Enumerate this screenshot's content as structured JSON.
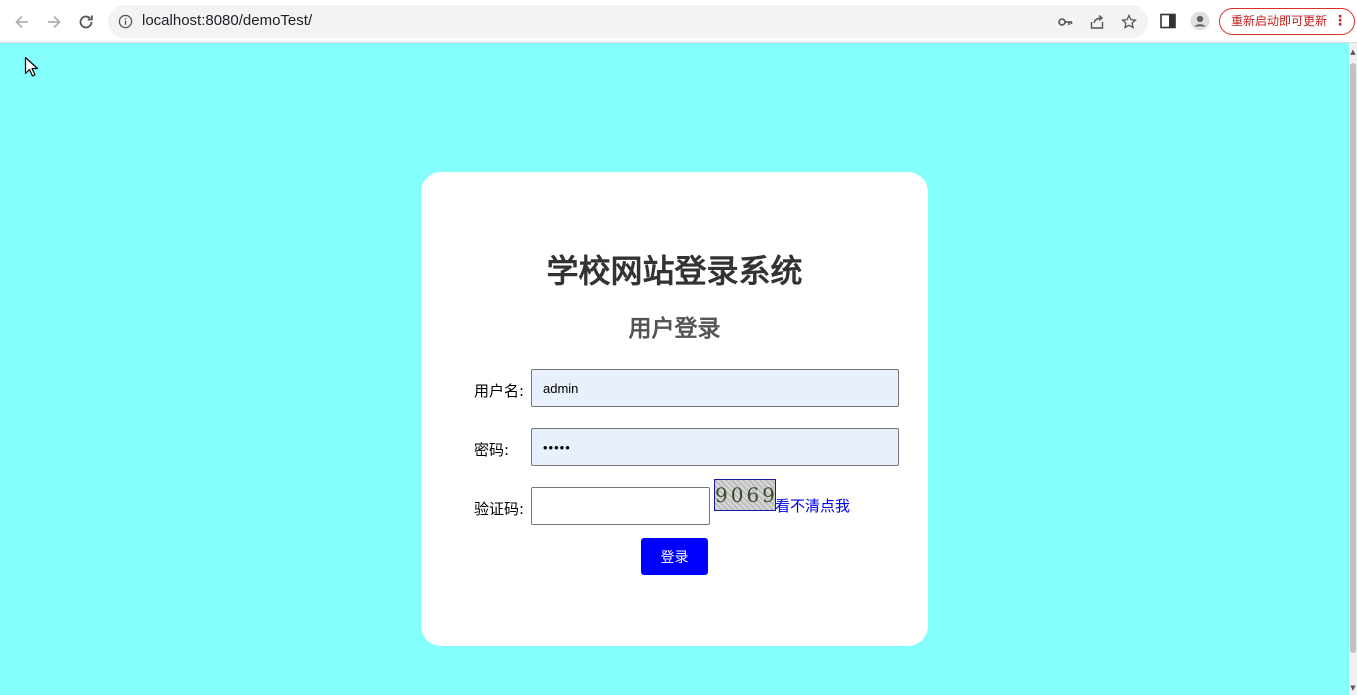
{
  "browser": {
    "url": "localhost:8080/demoTest/",
    "update_label": "重新启动即可更新",
    "menu_glyph": "⋮"
  },
  "login": {
    "title": "学校网站登录系统",
    "subtitle": "用户登录",
    "username_label": "用户名:",
    "username_value": "admin",
    "password_label": "密码:",
    "password_value": "admin",
    "captcha_label": "验证码:",
    "captcha_value": "",
    "captcha_image_text": "9069",
    "captcha_refresh_label": "看不清点我",
    "submit_label": "登录"
  },
  "colors": {
    "page_background": "#84fffe",
    "button": "#0000ff",
    "link": "#0000ee"
  }
}
